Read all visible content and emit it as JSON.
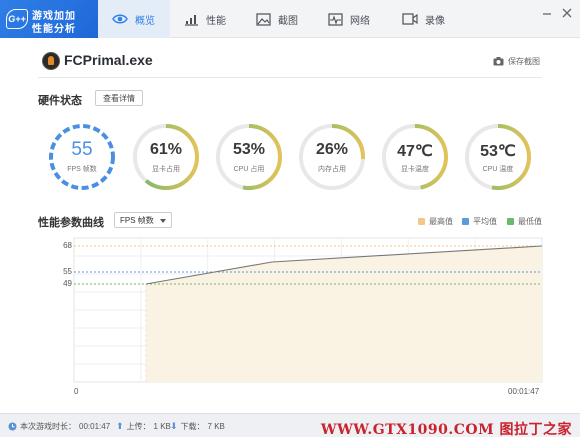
{
  "app": {
    "logo_line1": "游戏加加",
    "logo_line2": "性能分析",
    "logo_badge": "G++"
  },
  "tabs": [
    {
      "label": "概览",
      "icon": "eye-icon",
      "active": true
    },
    {
      "label": "性能",
      "icon": "bar-chart-icon",
      "active": false
    },
    {
      "label": "截图",
      "icon": "image-icon",
      "active": false
    },
    {
      "label": "网络",
      "icon": "pulse-icon",
      "active": false
    },
    {
      "label": "录像",
      "icon": "video-icon",
      "active": false
    }
  ],
  "process": {
    "name": "FCPrimal.exe",
    "save_label": "保存截图"
  },
  "hardware": {
    "title": "硬件状态",
    "details_label": "查看详情",
    "gauges": [
      {
        "value": "55",
        "label": "FPS 帧数",
        "level": 1.0
      },
      {
        "value": "61%",
        "label": "显卡占用",
        "level": 0.61
      },
      {
        "value": "53%",
        "label": "CPU 占用",
        "level": 0.53
      },
      {
        "value": "26%",
        "label": "内存占用",
        "level": 0.26
      },
      {
        "value": "47℃",
        "label": "显卡温度",
        "level": 0.47
      },
      {
        "value": "53℃",
        "label": "CPU 温度",
        "level": 0.53
      }
    ]
  },
  "curve": {
    "title": "性能参数曲线",
    "selected_metric": "FPS 帧数",
    "legend": [
      {
        "label": "最高值",
        "color": "#f0c987"
      },
      {
        "label": "平均值",
        "color": "#5b9bdc"
      },
      {
        "label": "最低值",
        "color": "#6db96b"
      }
    ]
  },
  "chart_data": {
    "type": "area",
    "x": [
      "00:00:10",
      "00:00:30",
      "00:01:47"
    ],
    "y": [
      49,
      60,
      68
    ],
    "max": 68,
    "avg": 55,
    "min": 49,
    "y_ticks": [
      "68",
      "55",
      "49"
    ],
    "x_ticks": [
      "0",
      "00:01:47"
    ],
    "ylim": [
      0,
      72
    ],
    "grid": true
  },
  "status": {
    "session_label": "本次游戏时长：",
    "session_value": "00:01:47",
    "upload_label": "上传：",
    "upload_value": "1 KB",
    "download_label": "下载：",
    "download_value": "7 KB"
  },
  "watermark": "WWW.GTX1090.COM 图拉丁之家",
  "colors": {
    "accent": "#2f7fe6",
    "gauge_ring_start": "#6db96b",
    "gauge_ring_end": "#e2c35a",
    "gauge_track": "#e8e8e8",
    "area_fill": "#faf3e3",
    "line": "#777777"
  }
}
